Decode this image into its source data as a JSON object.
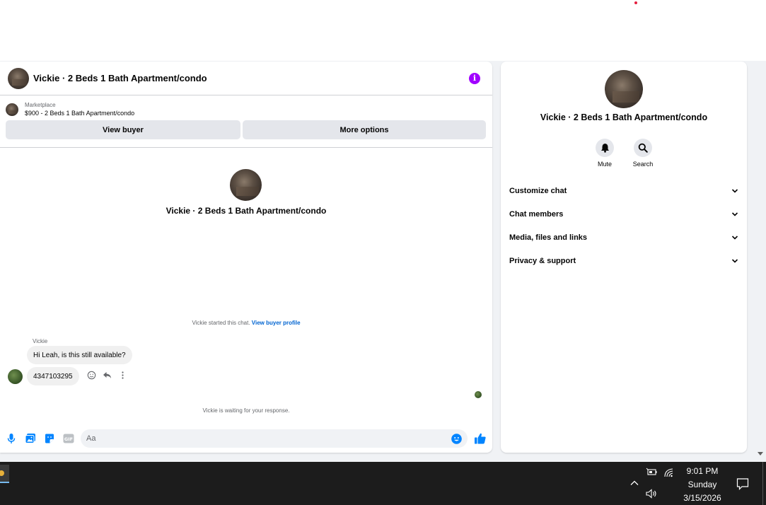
{
  "chat_header": {
    "title": "Vickie · 2 Beds 1 Bath Apartment/condo",
    "info_icon": "info-icon"
  },
  "listing": {
    "source": "Marketplace",
    "price_title": "$900 - 2 Beds 1 Bath Apartment/condo",
    "view_buyer_label": "View buyer",
    "more_options_label": "More options"
  },
  "thread": {
    "title": "Vickie · 2 Beds 1 Bath Apartment/condo",
    "started_text": "Vickie started this chat.",
    "buyer_profile_link": "View buyer profile",
    "sender_name": "Vickie",
    "messages": [
      {
        "text": "Hi Leah, is this still available?"
      },
      {
        "text": "4347103295"
      }
    ],
    "waiting_text": "Vickie is waiting for your response."
  },
  "composer": {
    "placeholder": "Aa",
    "icons": [
      "microphone-icon",
      "photo-icon",
      "sticker-icon",
      "gif-icon",
      "emoji-icon",
      "thumbs-up-icon"
    ]
  },
  "info_panel": {
    "title": "Vickie · 2 Beds 1 Bath Apartment/condo",
    "actions": [
      {
        "label": "Mute",
        "icon": "bell-icon"
      },
      {
        "label": "Search",
        "icon": "search-icon"
      }
    ],
    "sections": [
      {
        "label": "Customize chat"
      },
      {
        "label": "Chat members"
      },
      {
        "label": "Media, files and links"
      },
      {
        "label": "Privacy & support"
      }
    ]
  },
  "taskbar": {
    "time": "9:01 PM",
    "day": "Sunday",
    "date": "3/15/2026"
  },
  "colors": {
    "accent": "#0084ff",
    "info": "#a100ff",
    "link": "#0064d1",
    "taskbar": "#1c1c1c"
  }
}
